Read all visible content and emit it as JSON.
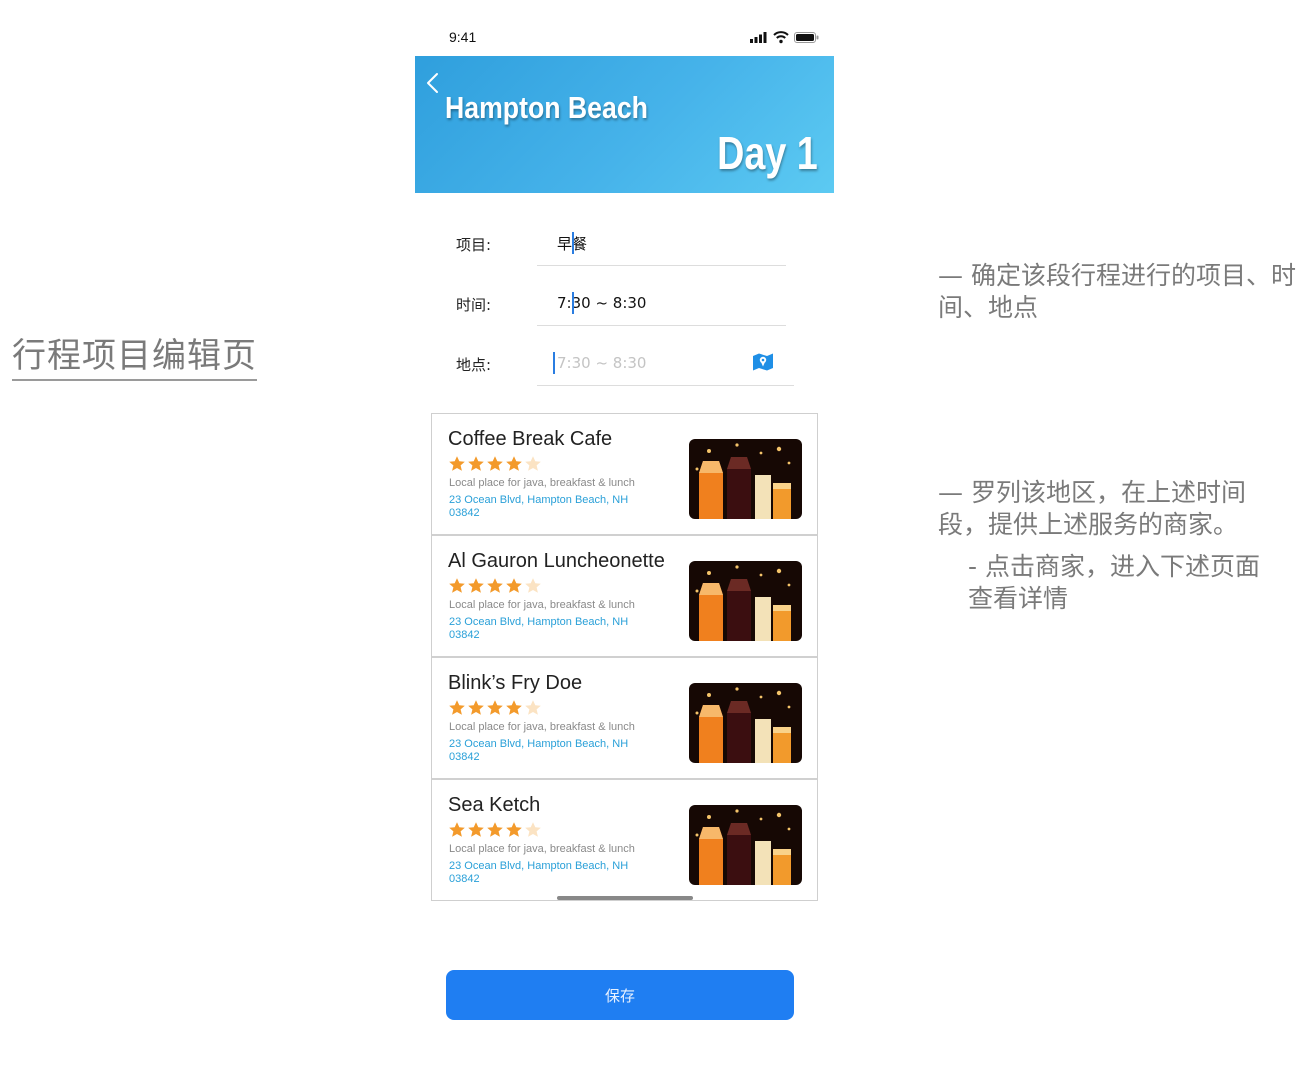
{
  "page": {
    "title": "行程项目编辑页"
  },
  "status_bar": {
    "time": "9:41",
    "icons": [
      "signal-icon",
      "wifi-icon",
      "battery-icon"
    ]
  },
  "header": {
    "back_icon": "chevron-left-icon",
    "title": "Hampton Beach",
    "day": "Day 1",
    "gradient_colors": [
      "#2f9fdd",
      "#5ccaf2"
    ]
  },
  "form": {
    "item": {
      "label": "项目:",
      "value": "早餐"
    },
    "time": {
      "label": "时间:",
      "value": "7:30 ~ 8:30"
    },
    "location": {
      "label": "地点:",
      "placeholder": "7:30 ~ 8:30",
      "icon": "map-icon"
    }
  },
  "merchants": [
    {
      "name": "Coffee Break Cafe",
      "rating": 4,
      "rating_max": 5,
      "description": "Local place for java, breakfast & lunch",
      "address": "23 Ocean Blvd, Hampton Beach, NH 03842"
    },
    {
      "name": "Al Gauron Luncheonette",
      "rating": 4,
      "rating_max": 5,
      "description": "Local place for java, breakfast & lunch",
      "address": "23 Ocean Blvd, Hampton Beach, NH 03842"
    },
    {
      "name": "Blink’s Fry Doe",
      "rating": 4,
      "rating_max": 5,
      "description": "Local place for java, breakfast & lunch",
      "address": "23 Ocean Blvd, Hampton Beach, NH 03842"
    },
    {
      "name": "Sea Ketch",
      "rating": 4,
      "rating_max": 5,
      "description": "Local place for java, breakfast & lunch",
      "address": "23 Ocean Blvd, Hampton Beach, NH 03842"
    }
  ],
  "save_label": "保存",
  "colors": {
    "accent": "#1f7ef2",
    "star": "#f39a2b",
    "star_empty": "#fbe3c3",
    "address": "#2aa0d8"
  },
  "annotations": {
    "note1": "— 确定该段行程进行的项目、时间、地点",
    "note2": "— 罗列该地区，在上述时间段，提供上述服务的商家。",
    "note3": "- 点击商家，进入下述页面查看详情"
  }
}
